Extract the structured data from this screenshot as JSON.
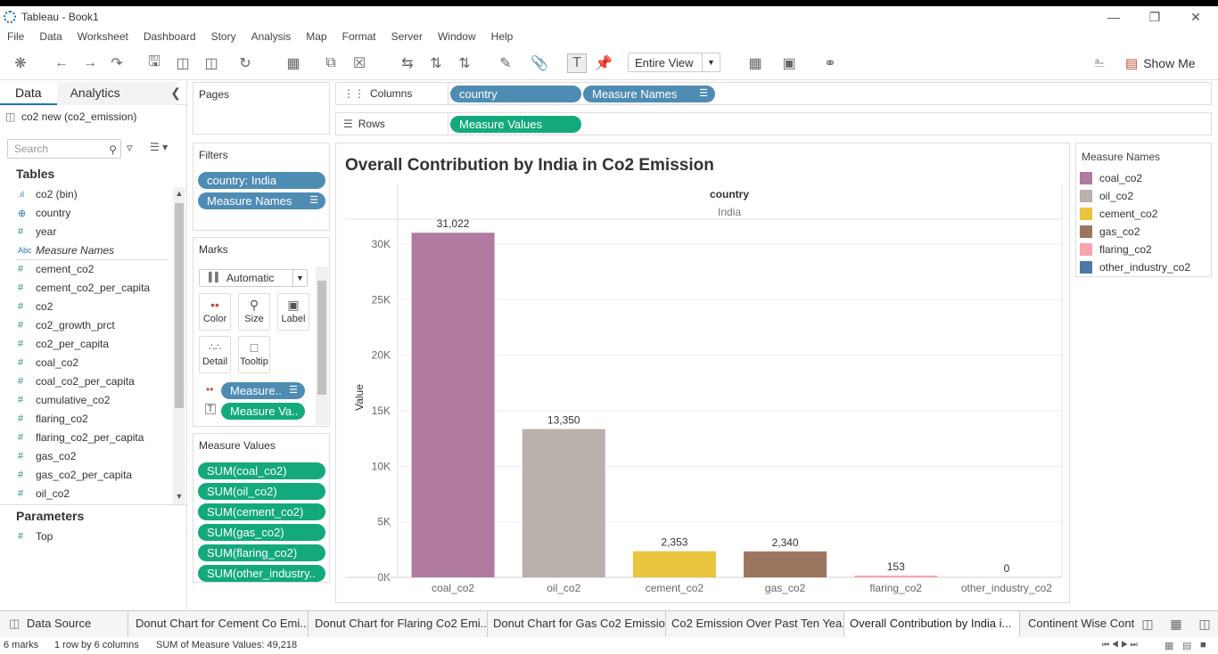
{
  "window": {
    "title": "Tableau - Book1"
  },
  "menu": [
    "File",
    "Data",
    "Worksheet",
    "Dashboard",
    "Story",
    "Analysis",
    "Map",
    "Format",
    "Server",
    "Window",
    "Help"
  ],
  "toolbar": {
    "fit": "Entire View",
    "show_me": "Show Me"
  },
  "data_pane": {
    "tab_data": "Data",
    "tab_analytics": "Analytics",
    "datasource": "co2 new (co2_emission)",
    "search_placeholder": "Search",
    "tables_title": "Tables",
    "fields": [
      {
        "icon": "bin",
        "name": "co2 (bin)"
      },
      {
        "icon": "globe",
        "name": "country"
      },
      {
        "icon": "hash",
        "name": "year"
      },
      {
        "icon": "abc",
        "name": "Measure Names"
      },
      {
        "icon": "hash",
        "name": "cement_co2"
      },
      {
        "icon": "hash",
        "name": "cement_co2_per_capita"
      },
      {
        "icon": "hash",
        "name": "co2"
      },
      {
        "icon": "hash",
        "name": "co2_growth_prct"
      },
      {
        "icon": "hash",
        "name": "co2_per_capita"
      },
      {
        "icon": "hash",
        "name": "coal_co2"
      },
      {
        "icon": "hash",
        "name": "coal_co2_per_capita"
      },
      {
        "icon": "hash",
        "name": "cumulative_co2"
      },
      {
        "icon": "hash",
        "name": "flaring_co2"
      },
      {
        "icon": "hash",
        "name": "flaring_co2_per_capita"
      },
      {
        "icon": "hash",
        "name": "gas_co2"
      },
      {
        "icon": "hash",
        "name": "gas_co2_per_capita"
      },
      {
        "icon": "hash",
        "name": "oil_co2"
      }
    ],
    "parameters_title": "Parameters",
    "parameters": [
      "Top"
    ]
  },
  "pages": {
    "title": "Pages"
  },
  "filters": {
    "title": "Filters",
    "items": [
      "country: India",
      "Measure Names"
    ]
  },
  "marks": {
    "title": "Marks",
    "type": "Automatic",
    "buttons": [
      "Color",
      "Size",
      "Label",
      "Detail",
      "Tooltip"
    ],
    "pills": [
      "Measure..",
      "Measure Va.."
    ]
  },
  "measure_values": {
    "title": "Measure Values",
    "items": [
      "SUM(coal_co2)",
      "SUM(oil_co2)",
      "SUM(cement_co2)",
      "SUM(gas_co2)",
      "SUM(flaring_co2)",
      "SUM(other_industry.."
    ]
  },
  "shelves": {
    "columns_label": "Columns",
    "columns": [
      "country",
      "Measure Names"
    ],
    "rows_label": "Rows",
    "rows": [
      "Measure Values"
    ]
  },
  "chart_data": {
    "type": "bar",
    "title": "Overall Contribution by India in Co2  Emission",
    "header_label": "country",
    "header_value": "India",
    "ylabel": "Value",
    "ylim": [
      0,
      32000
    ],
    "yticks": [
      "0K",
      "5K",
      "10K",
      "15K",
      "20K",
      "25K",
      "30K"
    ],
    "ytick_values": [
      0,
      5000,
      10000,
      15000,
      20000,
      25000,
      30000
    ],
    "categories": [
      "coal_co2",
      "oil_co2",
      "cement_co2",
      "gas_co2",
      "flaring_co2",
      "other_industry_co2"
    ],
    "values": [
      31022,
      13350,
      2353,
      2340,
      153,
      0
    ],
    "labels": [
      "31,022",
      "13,350",
      "2,353",
      "2,340",
      "153",
      "0"
    ],
    "colors": [
      "#b07aa1",
      "#bab0ac",
      "#e9c43f",
      "#9c7560",
      "#f7a6ae",
      "#4e79a7"
    ]
  },
  "legend": {
    "title": "Measure Names",
    "items": [
      {
        "name": "coal_co2",
        "color": "#b07aa1"
      },
      {
        "name": "oil_co2",
        "color": "#bab0ac"
      },
      {
        "name": "cement_co2",
        "color": "#e9c43f"
      },
      {
        "name": "gas_co2",
        "color": "#9c7560"
      },
      {
        "name": "flaring_co2",
        "color": "#f7a6ae"
      },
      {
        "name": "other_industry_co2",
        "color": "#4e79a7"
      }
    ]
  },
  "sheet_tabs": {
    "datasource": "Data Source",
    "tabs": [
      "Donut Chart for Cement Co Emi...",
      "Donut Chart for Flaring Co2 Emi...",
      "Donut Chart for Gas Co2 Emission",
      "Co2 Emission Over Past Ten Yea...",
      "Overall Contribution by India i...",
      "Continent Wise Contr"
    ]
  },
  "status": {
    "marks": "6 marks",
    "rows_cols": "1 row by 6 columns",
    "sum": "SUM of Measure Values: 49,218"
  }
}
